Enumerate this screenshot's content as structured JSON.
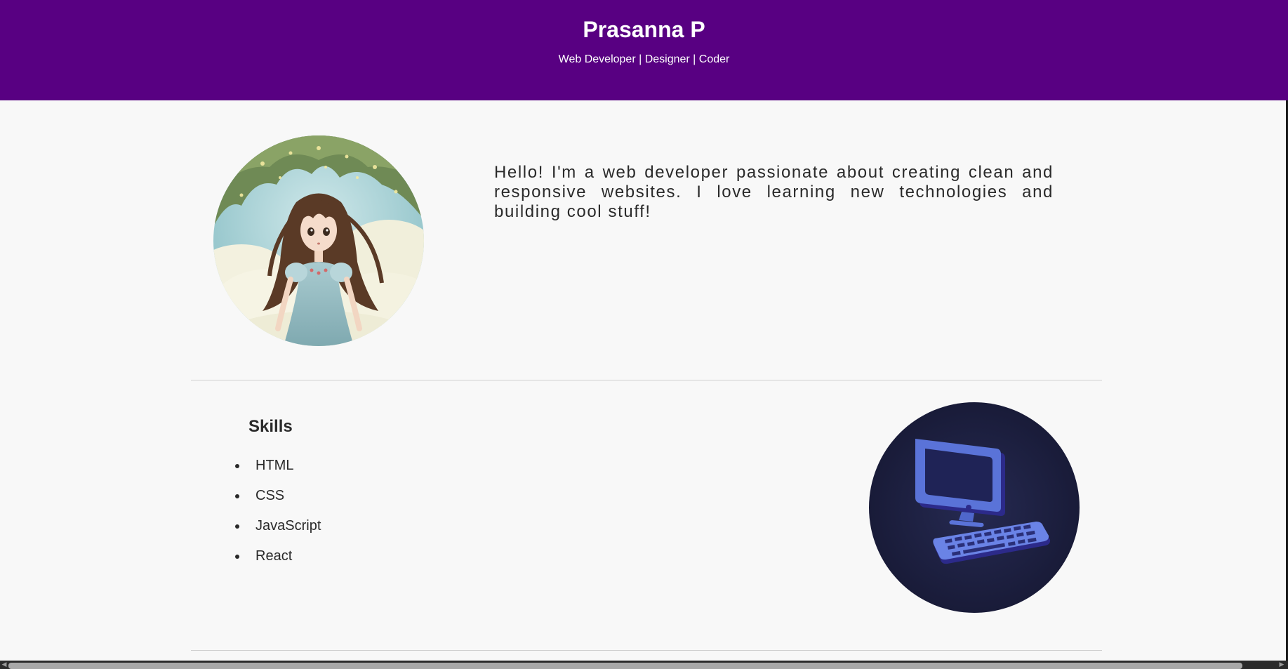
{
  "header": {
    "name": "Prasanna P",
    "tagline": "Web Developer | Designer | Coder"
  },
  "about": {
    "text": "Hello! I'm a web developer passionate about creating clean and responsive websites. I love learning new technologies and building cool stuff!",
    "image": "anime-girl-avatar"
  },
  "skills": {
    "title": "Skills",
    "items": [
      "HTML",
      "CSS",
      "JavaScript",
      "React"
    ],
    "image": "computer-icon"
  },
  "colors": {
    "header_bg": "#580082",
    "page_bg": "#f8f8f8",
    "text": "#2a2a2a"
  }
}
